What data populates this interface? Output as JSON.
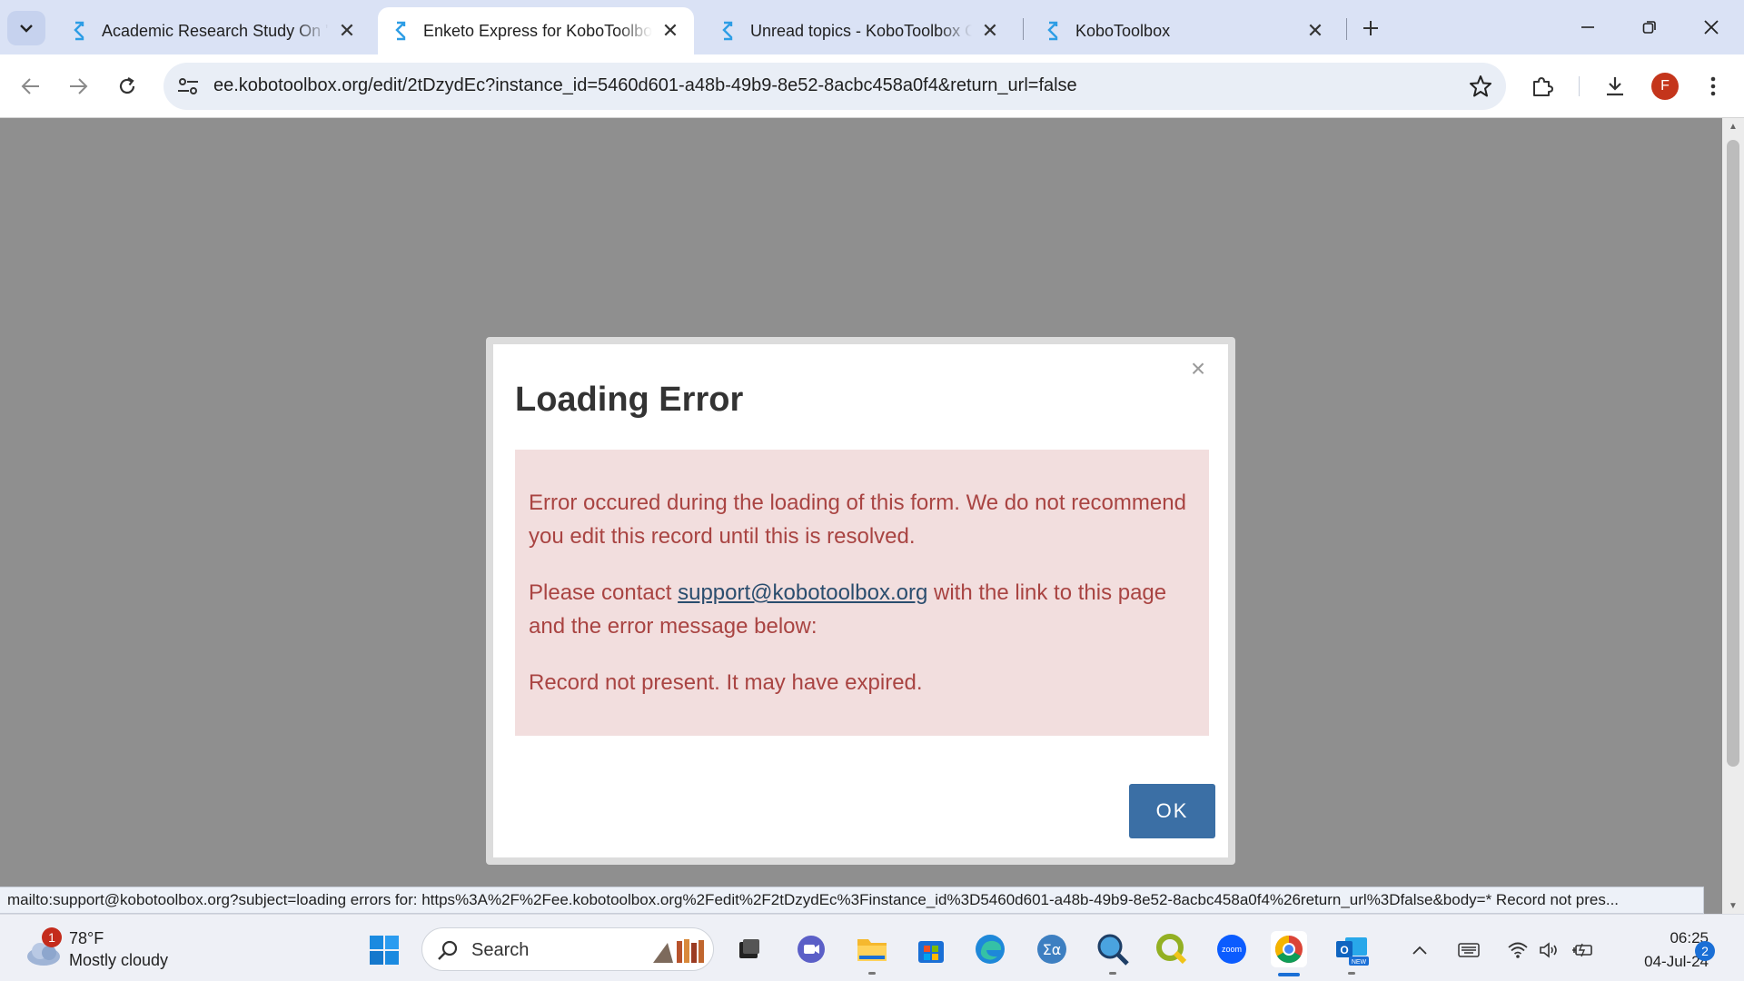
{
  "browser": {
    "tabs": [
      {
        "title": "Academic Research Study On \"L",
        "active": false
      },
      {
        "title": "Enketo Express for KoboToolbox",
        "active": true
      },
      {
        "title": "Unread topics - KoboToolbox Community",
        "active": false
      },
      {
        "title": "KoboToolbox",
        "active": false
      }
    ],
    "url": "ee.kobotoolbox.org/edit/2tDzydEc?instance_id=5460d601-a48b-49b9-8e52-8acbc458a0f4&return_url=false",
    "profile_initial": "F",
    "status_url": "mailto:support@kobotoolbox.org?subject=loading errors for: https%3A%2F%2Fee.kobotoolbox.org%2Fedit%2F2tDzydEc%3Finstance_id%3D5460d601-a48b-49b9-8e52-8acbc458a0f4%26return_url%3Dfalse&body=* Record not pres..."
  },
  "dialog": {
    "title": "Loading Error",
    "close_glyph": "×",
    "message_1": "Error occured during the loading of this form. We do not recommend you edit this record until this is resolved.",
    "message_2_prefix": "Please contact ",
    "support_email": "support@kobotoolbox.org",
    "message_2_suffix": " with the link to this page and the error message below:",
    "error_detail": "Record not present. It may have expired.",
    "ok_label": "OK"
  },
  "taskbar": {
    "weather_badge": "1",
    "weather_temp": "78°F",
    "weather_desc": "Mostly cloudy",
    "search_placeholder": "Search",
    "zoom_label": "zoom",
    "outlook_badge": "NEW",
    "time": "06:25",
    "date": "04-Jul-24",
    "notification_count": "2"
  },
  "colors": {
    "kobo_blue": "#2d9de5",
    "alert_bg": "#f2dede",
    "alert_text": "#a94442",
    "ok_button": "#3b6fa5"
  }
}
